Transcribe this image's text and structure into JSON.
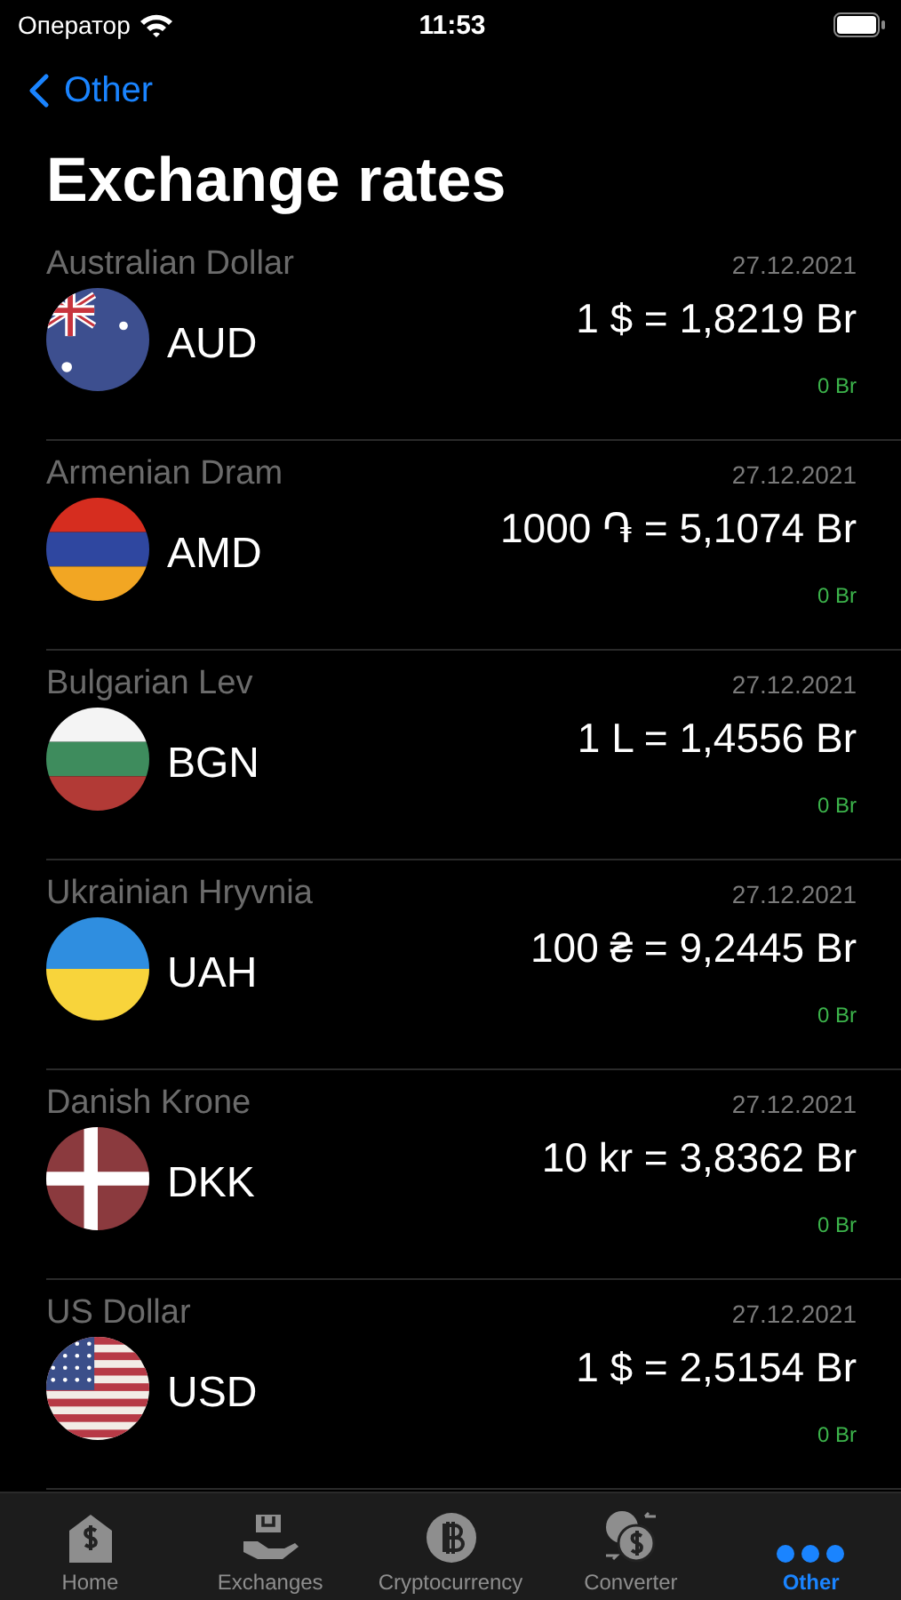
{
  "status_bar": {
    "carrier": "Оператор",
    "time": "11:53"
  },
  "nav": {
    "back_label": "Other"
  },
  "title": "Exchange rates",
  "rates": [
    {
      "name": "Australian Dollar",
      "date": "27.12.2021",
      "code": "AUD",
      "rate": "1 $ = 1,8219 Br",
      "change": "0 Br"
    },
    {
      "name": "Armenian Dram",
      "date": "27.12.2021",
      "code": "AMD",
      "rate": "1000 ֏ = 5,1074 Br",
      "change": "0 Br"
    },
    {
      "name": "Bulgarian Lev",
      "date": "27.12.2021",
      "code": "BGN",
      "rate": "1 L = 1,4556 Br",
      "change": "0 Br"
    },
    {
      "name": "Ukrainian Hryvnia",
      "date": "27.12.2021",
      "code": "UAH",
      "rate": "100 ₴ = 9,2445 Br",
      "change": "0 Br"
    },
    {
      "name": "Danish Krone",
      "date": "27.12.2021",
      "code": "DKK",
      "rate": "10 kr = 3,8362 Br",
      "change": "0 Br"
    },
    {
      "name": "US Dollar",
      "date": "27.12.2021",
      "code": "USD",
      "rate": "1 $ = 2,5154 Br",
      "change": "0 Br"
    }
  ],
  "tabs": [
    {
      "label": "Home",
      "kind": "home",
      "selected": false
    },
    {
      "label": "Exchanges",
      "kind": "exchanges",
      "selected": false
    },
    {
      "label": "Cryptocurrency",
      "kind": "crypto",
      "selected": false
    },
    {
      "label": "Converter",
      "kind": "converter",
      "selected": false
    },
    {
      "label": "Other",
      "kind": "other",
      "selected": true
    }
  ]
}
